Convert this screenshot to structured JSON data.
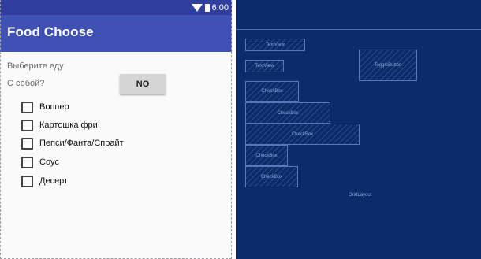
{
  "status_bar": {
    "time": "6:00",
    "icons": [
      "signal-icon",
      "battery-icon"
    ]
  },
  "app_bar": {
    "title": "Food Choose"
  },
  "form": {
    "prompt": "Выберите еду",
    "takeaway_label": "С собой?",
    "toggle_text": "NO"
  },
  "food_items": [
    {
      "label": "Воппер",
      "checked": false
    },
    {
      "label": "Картошка фри",
      "checked": false
    },
    {
      "label": "Пепси/Фанта/Спрайт",
      "checked": false
    },
    {
      "label": "Соус",
      "checked": false
    },
    {
      "label": "Десерт",
      "checked": false
    }
  ],
  "blueprint": {
    "textview_1": "TextView",
    "textview_2": "TextView",
    "toggle": "ToggleButton",
    "checkboxes": [
      "CheckBox",
      "CheckBox",
      "CheckBox",
      "CheckBox",
      "CheckBox"
    ],
    "layout": "GridLayout"
  },
  "colors": {
    "status_bar": "#303f9f",
    "app_bar": "#3f51b5",
    "blueprint_bg": "#0b2b6b",
    "blueprint_line": "#5a76b8"
  }
}
